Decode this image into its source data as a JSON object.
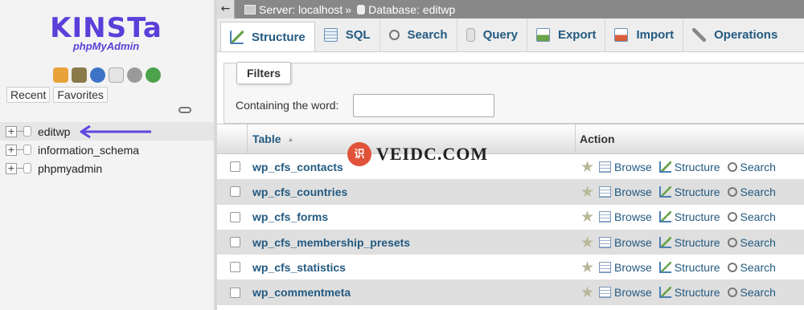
{
  "sidebar": {
    "logo_text": "KINSTa",
    "logo_sub": "phpMyAdmin",
    "quick_icons": [
      "home-icon",
      "exit-icon",
      "help-icon",
      "docs-icon",
      "settings-icon",
      "reload-icon"
    ],
    "tabs": [
      "Recent",
      "Favorites"
    ],
    "databases": [
      "editwp",
      "information_schema",
      "phpmyadmin"
    ],
    "active_db": "editwp",
    "expander": "+"
  },
  "breadcrumb": {
    "back": "←",
    "server": "Server: localhost",
    "separator": "»",
    "database": "Database: editwp"
  },
  "tabs": [
    {
      "label": "Structure",
      "icon": "structure-icon",
      "active": true
    },
    {
      "label": "SQL",
      "icon": "sql-icon"
    },
    {
      "label": "Search",
      "icon": "search-icon"
    },
    {
      "label": "Query",
      "icon": "query-icon"
    },
    {
      "label": "Export",
      "icon": "export-icon"
    },
    {
      "label": "Import",
      "icon": "import-icon"
    },
    {
      "label": "Operations",
      "icon": "operations-icon"
    }
  ],
  "filters": {
    "legend": "Filters",
    "label": "Containing the word:",
    "value": ""
  },
  "table": {
    "col_table": "Table",
    "sort_indicator": "▲",
    "col_action": "Action",
    "rows": [
      {
        "name": "wp_cfs_contacts"
      },
      {
        "name": "wp_cfs_countries"
      },
      {
        "name": "wp_cfs_forms"
      },
      {
        "name": "wp_cfs_membership_presets"
      },
      {
        "name": "wp_cfs_statistics"
      },
      {
        "name": "wp_commentmeta"
      }
    ],
    "actions": {
      "browse": "Browse",
      "structure": "Structure",
      "search": "Search",
      "favorite": "★"
    }
  },
  "watermark": {
    "badge": "识",
    "text": "VEIDC.COM"
  },
  "colors": {
    "brand": "#5b3fd9",
    "link": "#235a81",
    "breadcrumb_bg": "#888888",
    "arrow": "#5d46e0"
  }
}
